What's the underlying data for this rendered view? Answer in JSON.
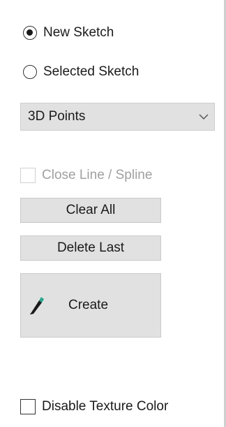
{
  "sketch_mode": {
    "options": [
      {
        "label": "New Sketch",
        "checked": true
      },
      {
        "label": "Selected Sketch",
        "checked": false
      }
    ]
  },
  "point_type": {
    "selected": "3D Points"
  },
  "close_line": {
    "label": "Close Line / Spline",
    "checked": false,
    "enabled": false
  },
  "buttons": {
    "clear_all": "Clear All",
    "delete_last": "Delete Last",
    "create": "Create"
  },
  "disable_texture": {
    "label": "Disable Texture Color",
    "checked": false
  },
  "icons": {
    "create": "pencil-icon",
    "dropdown": "chevron-down-icon"
  },
  "colors": {
    "button_bg": "#e1e1e1",
    "pencil_tip": "#2aa58c"
  }
}
